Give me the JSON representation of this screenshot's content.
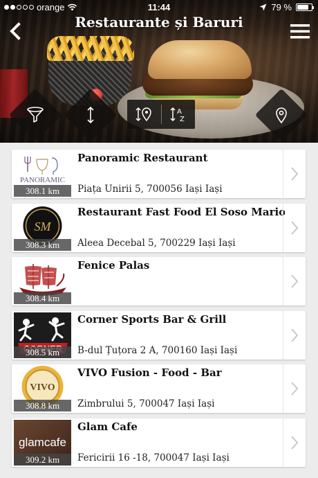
{
  "status_bar": {
    "carrier": "orange",
    "signal_dots_on": 2,
    "signal_dots_total": 5,
    "time": "11:44",
    "battery": "79 %",
    "battery_level": 0.79
  },
  "header": {
    "title": "Restaurante și Baruri",
    "back_icon": "chevron-left-icon",
    "menu_icon": "hamburger-menu-icon"
  },
  "actions": {
    "filter_icon": "filter-funnel-icon",
    "sort_icon": "sort-arrows-icon",
    "sort_distance_icon": "sort-by-distance-icon",
    "sort_alpha_icon": "sort-alphabetical-icon",
    "sort_alpha_letters": {
      "top": "A",
      "bottom": "Z"
    },
    "map_icon": "map-pin-icon"
  },
  "restaurants": [
    {
      "name": "Panoramic Restaurant",
      "distance": "308.1 km",
      "address": "Piața Unirii 5, 700056 Iași Iași",
      "logo_text": "PANORAMIC"
    },
    {
      "name": "Restaurant Fast Food El Soso Mario",
      "distance": "308.3 km",
      "address": "Aleea Decebal 5, 700229 Iași Iași",
      "logo_text": "SM"
    },
    {
      "name": "Fenice Palas",
      "distance": "308.4 km",
      "address": "",
      "logo_text": ""
    },
    {
      "name": "Corner Sports Bar & Grill",
      "distance": "308.5 km",
      "address": "B-dul Țuțora 2 A, 700160 Iași Iași",
      "logo_text": "CORNER"
    },
    {
      "name": "VIVO Fusion - Food - Bar",
      "distance": "308.8 km",
      "address": "Zimbrului 5, 700047 Iași Iași",
      "logo_text": "VIVO"
    },
    {
      "name": "Glam Cafe",
      "distance": "309.2 km",
      "address": "Fericirii 16 -18, 700047 Iași Iași",
      "logo_text": "glamcafe"
    }
  ],
  "colors": {
    "card_bg": "#ffffff",
    "list_bg": "#ececec",
    "button_bg": "#121010",
    "badge_bg": "#464646"
  }
}
